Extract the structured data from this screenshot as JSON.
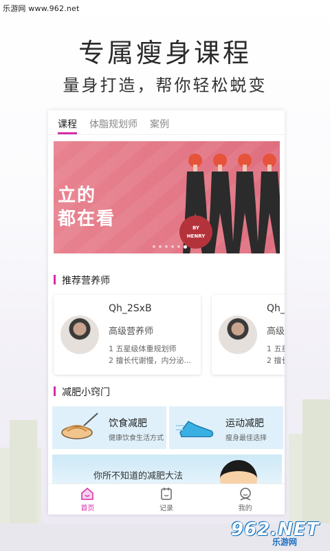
{
  "watermark": "乐游网 www.962.net",
  "promo": {
    "headline": "专属瘦身课程",
    "subheadline": "量身打造，帮你轻松蜕变"
  },
  "tabs": [
    {
      "label": "课程",
      "active": true
    },
    {
      "label": "体脂规划师",
      "active": false
    },
    {
      "label": "案例",
      "active": false
    }
  ],
  "banner": {
    "line1": "立的",
    "line2": "都在看",
    "stamp_line1": "BY",
    "stamp_line2": "HENRY",
    "carousel_count": 6,
    "carousel_active": 5
  },
  "nutritionist_section": {
    "title": "推荐营养师",
    "cards": [
      {
        "name": "Qh_2SxB",
        "role": "高级营养师",
        "line1": "1 五星级体重规划师",
        "line2": "2 擅长代谢慢，内分泌..."
      },
      {
        "name": "Qh_",
        "role": "高级",
        "line1": "1 五星",
        "line2": "2 擅长"
      }
    ]
  },
  "tips_section": {
    "title": "减肥小窍门",
    "items": [
      {
        "title": "饮食减肥",
        "subtitle": "健康饮食生活方式",
        "icon": "noodle-bowl-icon"
      },
      {
        "title": "运动减肥",
        "subtitle": "瘦身最佳选择",
        "icon": "sneaker-icon"
      }
    ],
    "banner_text": "你所不知道的减肥大法"
  },
  "bottom_nav": [
    {
      "label": "首页",
      "icon": "home-icon",
      "active": true
    },
    {
      "label": "记录",
      "icon": "record-icon",
      "active": false
    },
    {
      "label": "我的",
      "icon": "profile-icon",
      "active": false
    }
  ],
  "site_logo": {
    "text": "962.NET",
    "sub": "乐游网"
  },
  "colors": {
    "accent": "#d62da8",
    "banner": "#e07a88",
    "tip_background": "#dff0fa"
  }
}
